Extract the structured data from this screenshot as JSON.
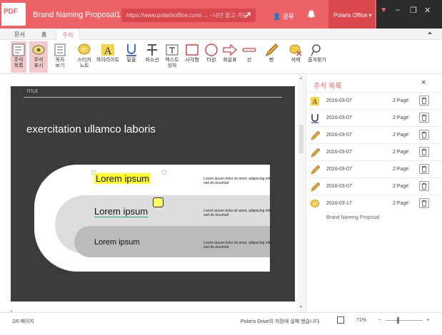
{
  "titlebar": {
    "app_badge": "PDF",
    "doc_title": "Brand Naming Proposal1.pdf",
    "url": "https://www.polarisoffice.com/ ... - 나만 참고 가능",
    "share": "공유",
    "account": "Polaris Office ▾",
    "accent": "#ec6267"
  },
  "tabs": [
    "문서",
    "홈",
    "주석"
  ],
  "ribbon": [
    {
      "label": "주석\n목록",
      "icon": "annotation-list-icon"
    },
    {
      "label": "주석\n표시",
      "icon": "annotation-show-icon"
    },
    {
      "label": "목차\n보기",
      "icon": "toc-icon"
    },
    {
      "label": "스티커\n노트",
      "icon": "sticky-note-icon"
    },
    {
      "label": "하이라이트",
      "icon": "highlight-icon"
    },
    {
      "label": "밑줄",
      "icon": "underline-icon"
    },
    {
      "label": "취소선",
      "icon": "strikethrough-icon"
    },
    {
      "label": "텍스트\n상자",
      "icon": "textbox-icon"
    },
    {
      "label": "사각형",
      "icon": "rectangle-icon"
    },
    {
      "label": "타원",
      "icon": "ellipse-icon"
    },
    {
      "label": "화살표",
      "icon": "arrow-icon"
    },
    {
      "label": "선",
      "icon": "line-icon"
    },
    {
      "label": "펜",
      "icon": "pen-icon"
    },
    {
      "label": "삭제",
      "icon": "delete-annotation-icon"
    },
    {
      "label": "즐겨찾기",
      "icon": "favorite-icon"
    }
  ],
  "slide": {
    "title_label": "TITLE",
    "heading": "exercitation ullamco laboris",
    "items": [
      {
        "lorem": "Lorem ipsum",
        "body": "Lorem ipsum dolor sit amet, adipiscing elit, sed do eiusmod"
      },
      {
        "lorem": "Lorem ipsum",
        "body": "Lorem ipsum dolor sit amet, adipiscing elit, sed do eiusmod"
      },
      {
        "lorem": "Lorem ipsum",
        "body": "Lorem ipsum dolor sit amet, adipiscing elit, sed do eiusmod"
      }
    ]
  },
  "panel": {
    "title": "주석 목록",
    "close": "×",
    "rows": [
      {
        "icon": "highlight-icon",
        "date": "2016-03-07",
        "page": "2 Page"
      },
      {
        "icon": "underline-icon",
        "date": "2016-03-07",
        "page": "2 Page"
      },
      {
        "icon": "pen-icon",
        "date": "2016-03-07",
        "page": "2 Page"
      },
      {
        "icon": "pen-icon",
        "date": "2016-03-07",
        "page": "2 Page"
      },
      {
        "icon": "pen-icon",
        "date": "2016-03-07",
        "page": "2 Page"
      },
      {
        "icon": "pen-icon",
        "date": "2016-03-07",
        "page": "2 Page"
      },
      {
        "icon": "sticky-note-icon",
        "date": "2016-03-17",
        "page": "2 Page"
      }
    ],
    "last_row_subtitle": "Brand Naming Proposal"
  },
  "status": {
    "page_info": "2/6 페이지",
    "save_status": "Polaris Drive의 저장에 실패 했습니다.",
    "zoom": "71%"
  }
}
